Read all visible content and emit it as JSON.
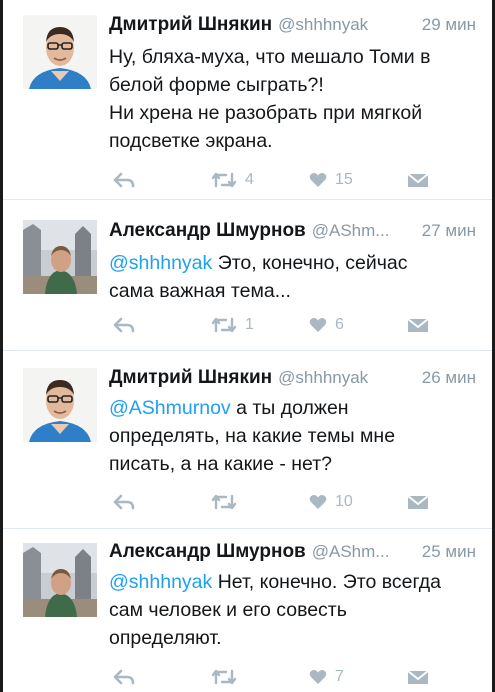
{
  "tweets": [
    {
      "name": "Дмитрий Шнякин",
      "handle": "@shhhnyak",
      "time": "29 мин",
      "lines": [
        "Ну, бляха-муха, что мешало Томи в",
        "белой форме сыграть?!",
        "Ни хрена не разобрать при мягкой",
        "подсветке экрана."
      ],
      "mention": "",
      "retweets": "4",
      "likes": "15",
      "avatar": "man-blue-shirt"
    },
    {
      "name": "Александр Шмурнов",
      "handle": "@AShm...",
      "time": "27 мин",
      "mention": "@shhhnyak",
      "lines": [
        " Это, конечно, сейчас",
        "сама важная тема..."
      ],
      "retweets": "1",
      "likes": "6",
      "avatar": "man-city-street"
    },
    {
      "name": "Дмитрий Шнякин",
      "handle": "@shhhnyak",
      "time": "26 мин",
      "mention": "@AShmurnov",
      "lines": [
        " а ты должен",
        "определять, на какие темы мне",
        "писать, а на какие - нет?"
      ],
      "retweets": "",
      "likes": "10",
      "avatar": "man-blue-shirt"
    },
    {
      "name": "Александр Шмурнов",
      "handle": "@AShm...",
      "time": "25 мин",
      "mention": "@shhhnyak",
      "lines": [
        " Нет, конечно. Это всегда",
        "сам человек и его совесть",
        "определяют."
      ],
      "retweets": "",
      "likes": "7",
      "avatar": "man-city-street"
    }
  ],
  "colors": {
    "mention": "#1da1f2",
    "meta": "#8899a6",
    "icon": "#aab8c2",
    "divider": "#e1e8ed"
  }
}
